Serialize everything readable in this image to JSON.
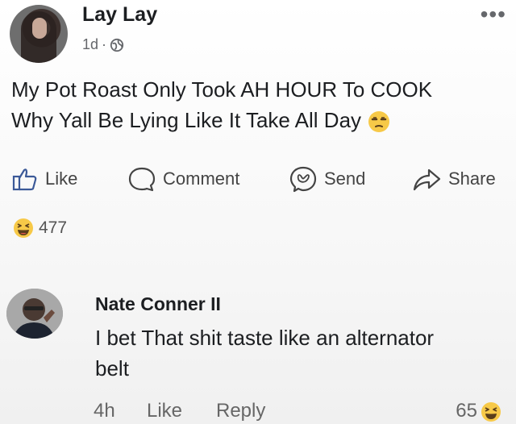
{
  "post": {
    "author": "Lay Lay",
    "time": "1d",
    "separator": "·",
    "line1": "My Pot Roast Only Took AH HOUR To COOK",
    "line2": "Why Yall Be Lying Like It Take All Day",
    "more": "•••"
  },
  "actions": {
    "like": "Like",
    "comment": "Comment",
    "send": "Send",
    "share": "Share"
  },
  "reactions": {
    "count": "477"
  },
  "comment": {
    "author": "Nate Conner II",
    "line1": "I bet That shit taste like an alternator",
    "line2": "belt",
    "time": "4h",
    "like": "Like",
    "reply": "Reply",
    "likes": "65"
  },
  "icons": {
    "more": "more-icon",
    "globe": "globe-icon",
    "like": "thumbs-up-icon",
    "comment": "comment-bubble-icon",
    "send": "messenger-icon",
    "share": "share-arrow-icon",
    "emoji_unamused": "unamused-face-icon",
    "emoji_laugh": "laughing-face-icon"
  }
}
